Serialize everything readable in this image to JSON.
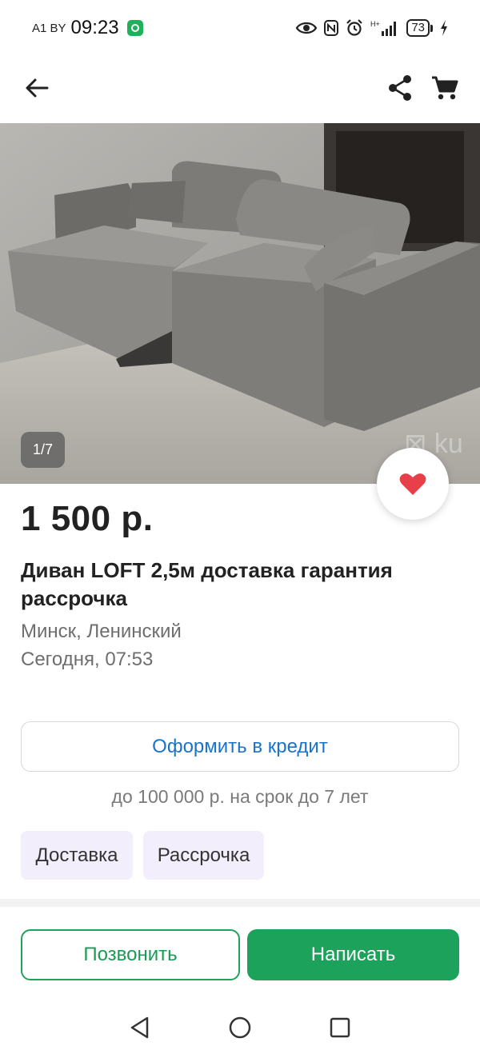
{
  "status_bar": {
    "carrier": "A1 BY",
    "time": "09:23",
    "battery": "73",
    "icons": [
      "eye-icon",
      "nfc-icon",
      "alarm-icon",
      "signal-icon",
      "battery-icon",
      "charging-icon"
    ]
  },
  "header": {
    "icons": [
      "back-arrow-icon",
      "share-icon",
      "cart-icon"
    ]
  },
  "listing": {
    "photo_counter": "1/7",
    "price": "1 500 р.",
    "title": "Диван LOFT 2,5м доставка гарантия рассрочка",
    "location": "Минск, Ленинский",
    "date": "Сегодня, 07:53"
  },
  "credit": {
    "button_label": "Оформить в кредит",
    "note": "до 100 000 р. на срок до 7 лет"
  },
  "tags": [
    "Доставка",
    "Рассрочка"
  ],
  "actions": {
    "call_label": "Позвонить",
    "write_label": "Написать"
  },
  "colors": {
    "accent_green": "#1ca25a",
    "link_blue": "#1a73c8",
    "heart_red": "#e8404a",
    "tag_bg": "#f3eefc"
  }
}
